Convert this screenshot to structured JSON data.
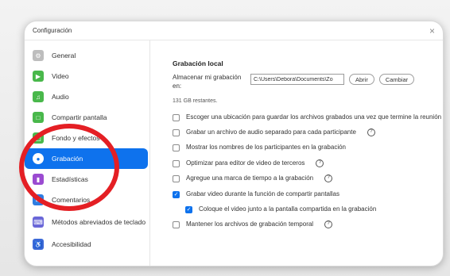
{
  "window": {
    "title": "Configuración",
    "close_glyph": "×"
  },
  "sidebar": {
    "items": [
      {
        "label": "General",
        "icon": "gear-icon",
        "color": "#bdbdbd"
      },
      {
        "label": "Video",
        "icon": "video-icon",
        "color": "#49b84b"
      },
      {
        "label": "Audio",
        "icon": "headphone-icon",
        "color": "#49b84b"
      },
      {
        "label": "Compartir pantalla",
        "icon": "share-screen-icon",
        "color": "#49b84b"
      },
      {
        "label": "Fondo y efectos",
        "icon": "background-effects-icon",
        "color": "#49b84b"
      },
      {
        "label": "Grabación",
        "icon": "record-icon",
        "color": "#0e72ed",
        "active": true
      },
      {
        "label": "Estadísticas",
        "icon": "statistics-icon",
        "color": "#9b4bd1"
      },
      {
        "label": "Comentarios",
        "icon": "comment-icon",
        "color": "#2e7de1"
      },
      {
        "label": "Métodos abreviados de teclado",
        "icon": "keyboard-icon",
        "color": "#6a67d8"
      },
      {
        "label": "Accesibilidad",
        "icon": "accessibility-icon",
        "color": "#3b69d8"
      }
    ]
  },
  "recording": {
    "title": "Grabación local",
    "store_label": "Almacenar mi grabación en:",
    "path_value": "C:\\Users\\Debora\\Documents\\Zo",
    "open_button": "Abrir",
    "change_button": "Cambiar",
    "free_space": "131 GB restantes.",
    "options": [
      {
        "text": "Escoger una ubicación para guardar los archivos grabados una vez que termine la reunión",
        "checked": false,
        "info": false,
        "indent": false
      },
      {
        "text": "Grabar un archivo de audio separado para cada participante",
        "checked": false,
        "info": true,
        "indent": false
      },
      {
        "text": "Mostrar los nombres de los participantes en la grabación",
        "checked": false,
        "info": false,
        "indent": false
      },
      {
        "text": "Optimizar para editor de video de terceros",
        "checked": false,
        "info": true,
        "indent": false
      },
      {
        "text": "Agregue una marca de tiempo a la grabación",
        "checked": false,
        "info": true,
        "indent": false
      },
      {
        "text": "Grabar video durante la función de compartir pantallas",
        "checked": true,
        "info": false,
        "indent": false
      },
      {
        "text": "Coloque el video junto a la pantalla compartida en la grabación",
        "checked": true,
        "info": false,
        "indent": true
      },
      {
        "text": "Mantener los archivos de grabación temporal",
        "checked": false,
        "info": true,
        "indent": false
      }
    ]
  },
  "colors": {
    "accent": "#0e72ed",
    "annotation": "#e41f24"
  }
}
